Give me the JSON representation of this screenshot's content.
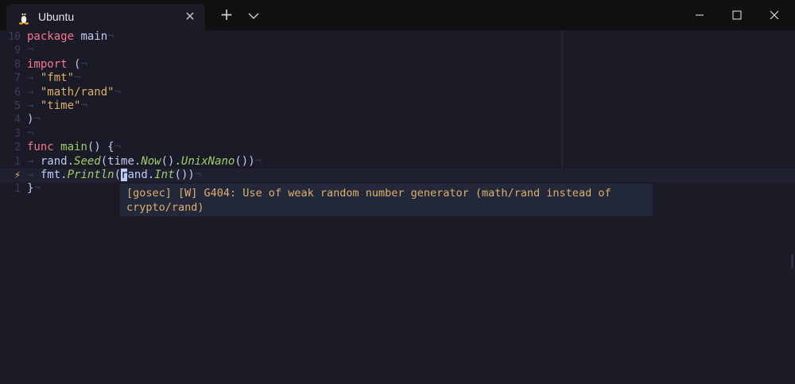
{
  "window": {
    "tab_title": "Ubuntu",
    "tab_icon": "linux-tux-icon",
    "close_tab_glyph": "✕",
    "new_tab_glyph": "+",
    "dropdown_glyph": "⌵",
    "minimize_glyph": "—",
    "maximize_glyph": "☐",
    "close_glyph": "✕"
  },
  "editor": {
    "eol_glyph": "¬",
    "indent_glyph": "→",
    "lines": [
      {
        "num": "10",
        "current": false,
        "tokens": [
          [
            "kw",
            "package"
          ],
          [
            "punct",
            " "
          ],
          [
            "pkg",
            "main"
          ]
        ]
      },
      {
        "num": "9",
        "current": false,
        "tokens": []
      },
      {
        "num": "8",
        "current": false,
        "tokens": [
          [
            "kw",
            "import"
          ],
          [
            "punct",
            " ("
          ]
        ]
      },
      {
        "num": "7",
        "current": false,
        "indent": true,
        "tokens": [
          [
            "str",
            "\"fmt\""
          ]
        ]
      },
      {
        "num": "6",
        "current": false,
        "indent": true,
        "tokens": [
          [
            "str",
            "\"math/rand\""
          ]
        ]
      },
      {
        "num": "5",
        "current": false,
        "indent": true,
        "tokens": [
          [
            "str",
            "\"time\""
          ]
        ]
      },
      {
        "num": "4",
        "current": false,
        "tokens": [
          [
            "punct",
            ")"
          ]
        ]
      },
      {
        "num": "3",
        "current": false,
        "tokens": []
      },
      {
        "num": "2",
        "current": false,
        "tokens": [
          [
            "kw",
            "func"
          ],
          [
            "punct",
            " "
          ],
          [
            "fn",
            "main"
          ],
          [
            "punct",
            "() {"
          ]
        ]
      },
      {
        "num": "1",
        "current": false,
        "indent": true,
        "tokens": [
          [
            "pkg",
            "rand"
          ],
          [
            "punct",
            "."
          ],
          [
            "meth",
            "Seed"
          ],
          [
            "punct",
            "("
          ],
          [
            "pkg",
            "time"
          ],
          [
            "punct",
            "."
          ],
          [
            "meth",
            "Now"
          ],
          [
            "punct",
            "()."
          ],
          [
            "meth",
            "UnixNano"
          ],
          [
            "punct",
            "())"
          ]
        ]
      },
      {
        "num": "⚡",
        "current": true,
        "indent": true,
        "tokens": [
          [
            "pkg",
            "fmt"
          ],
          [
            "punct",
            "."
          ],
          [
            "meth",
            "Println"
          ],
          [
            "punct",
            "("
          ],
          [
            "cursor",
            "r"
          ],
          [
            "pkg",
            "and"
          ],
          [
            "punct",
            "."
          ],
          [
            "meth",
            "Int"
          ],
          [
            "punct",
            "())"
          ]
        ]
      },
      {
        "num": "1",
        "current": false,
        "tokens": [
          [
            "punct",
            "}"
          ]
        ]
      }
    ]
  },
  "diagnostic": {
    "line1": "[gosec] [W] G404: Use of weak random number generator (math/rand instead of",
    "line2": "crypto/rand)"
  },
  "colors": {
    "background": "#1a1b26",
    "keyword": "#f7768e",
    "function": "#9ece6a",
    "string": "#e0af68",
    "foreground": "#c0caf5",
    "warning": "#e0af68"
  }
}
